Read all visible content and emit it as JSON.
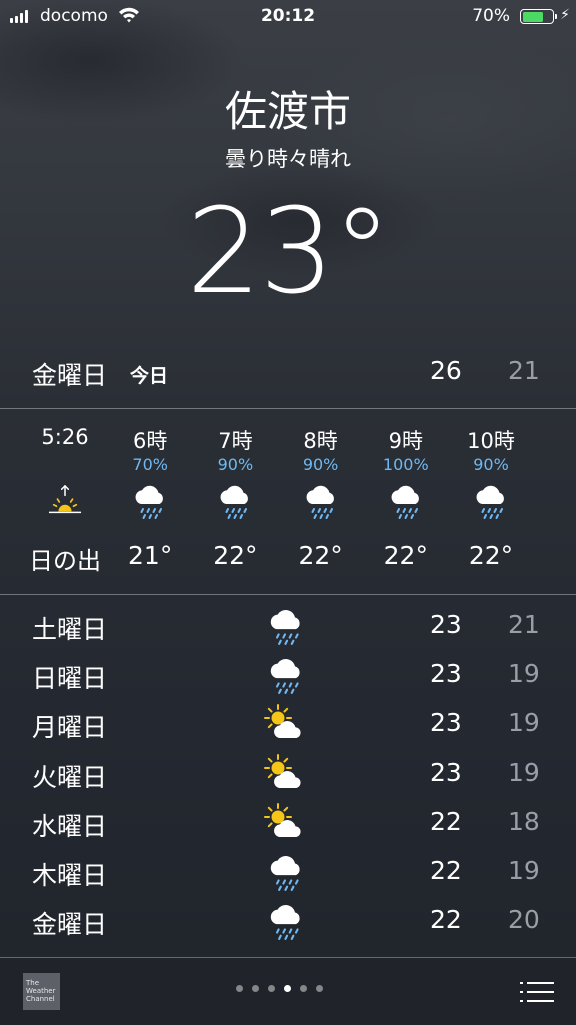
{
  "status": {
    "carrier": "docomo",
    "time": "20:12",
    "battery": "70%",
    "battery_level": 0.7
  },
  "location": {
    "city": "佐渡市",
    "condition": "曇り時々晴れ",
    "temperature": "23°"
  },
  "today": {
    "day": "金曜日",
    "badge": "今日",
    "high": "26",
    "low": "21"
  },
  "hourly": [
    {
      "label": "5:26",
      "pop": "",
      "icon": "sunrise-icon",
      "temp": "日の出"
    },
    {
      "label": "6時",
      "pop": "70%",
      "icon": "rain-cloud-icon",
      "temp": "21°"
    },
    {
      "label": "7時",
      "pop": "90%",
      "icon": "rain-cloud-icon",
      "temp": "22°"
    },
    {
      "label": "8時",
      "pop": "90%",
      "icon": "rain-cloud-icon",
      "temp": "22°"
    },
    {
      "label": "9時",
      "pop": "100%",
      "icon": "rain-cloud-icon",
      "temp": "22°"
    },
    {
      "label": "10時",
      "pop": "90%",
      "icon": "rain-cloud-icon",
      "temp": "22°"
    }
  ],
  "daily": [
    {
      "day": "土曜日",
      "icon": "rain-cloud-icon",
      "high": "23",
      "low": "21"
    },
    {
      "day": "日曜日",
      "icon": "rain-cloud-icon",
      "high": "23",
      "low": "19"
    },
    {
      "day": "月曜日",
      "icon": "partly-cloudy-icon",
      "high": "23",
      "low": "19"
    },
    {
      "day": "火曜日",
      "icon": "partly-cloudy-icon",
      "high": "23",
      "low": "19"
    },
    {
      "day": "水曜日",
      "icon": "partly-cloudy-icon",
      "high": "22",
      "low": "18"
    },
    {
      "day": "木曜日",
      "icon": "rain-cloud-icon",
      "high": "22",
      "low": "19"
    },
    {
      "day": "金曜日",
      "icon": "rain-cloud-icon",
      "high": "22",
      "low": "20"
    }
  ],
  "footer": {
    "logo_text": "The Weather Channel",
    "page_count": 6,
    "active_page": 3
  },
  "colors": {
    "precip": "#6fb8f2",
    "sun": "#f5c518",
    "low_temp": "#9a9ea6",
    "battery": "#4cd964"
  }
}
